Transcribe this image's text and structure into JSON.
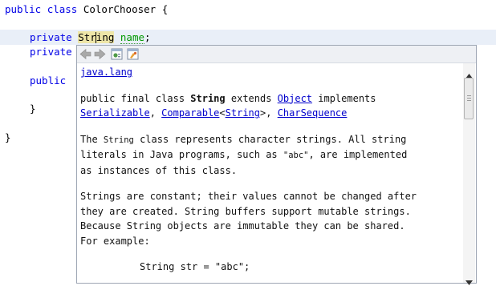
{
  "editor": {
    "class_decl": {
      "kw1": "public",
      "kw2": "class",
      "name": "ColorChooser",
      "brace": "{"
    },
    "field_decl": {
      "kw": "private",
      "type": "String",
      "name": "name",
      "semi": ";"
    },
    "line3": {
      "kw": "private"
    },
    "line4": {
      "kw": "public"
    },
    "close_inner": "}",
    "close_outer": "}"
  },
  "popup": {
    "toolbar": {
      "back": "back-icon",
      "forward": "forward-icon",
      "open_source": "open-source-icon",
      "open_browser": "open-in-browser-icon"
    },
    "package_link": "java.lang",
    "decl": {
      "prefix": "public final class ",
      "class_name": "String",
      "extends": " extends ",
      "super_link": "Object",
      "implements": " implements",
      "iface1": "Serializable",
      "sep1": ", ",
      "iface2": "Comparable",
      "lt": "<",
      "iface2_arg": "String",
      "gt": ">",
      "sep2": ", ",
      "iface3": "CharSequence"
    },
    "para1": {
      "pre": "The ",
      "code": "String",
      "line1_rest": " class represents character strings. All string",
      "line2_pre": "literals in Java programs, such as ",
      "line2_code": "\"abc\"",
      "line2_rest": ", are implemented",
      "line3": "as instances of this class."
    },
    "para2": {
      "line1": "Strings are constant; their values cannot be changed after",
      "line2": "they are created. String buffers support mutable strings.",
      "line3": "Because String objects are immutable they can be shared.",
      "line4": "For example:"
    },
    "example": "String str = \"abc\";"
  }
}
